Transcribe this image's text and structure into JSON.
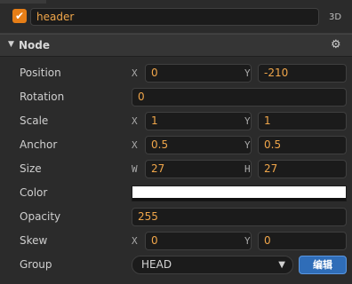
{
  "header": {
    "checked": true,
    "check_glyph": "✔",
    "node_name": "header",
    "mode_tag": "3D"
  },
  "section": {
    "caret": "▼",
    "title": "Node",
    "settings_glyph": "⚙"
  },
  "position": {
    "label": "Position",
    "x_axis": "X",
    "x": "0",
    "y_axis": "Y",
    "y": "-210"
  },
  "rotation": {
    "label": "Rotation",
    "value": "0"
  },
  "scale": {
    "label": "Scale",
    "x_axis": "X",
    "x": "1",
    "y_axis": "Y",
    "y": "1"
  },
  "anchor": {
    "label": "Anchor",
    "x_axis": "X",
    "x": "0.5",
    "y_axis": "Y",
    "y": "0.5"
  },
  "size": {
    "label": "Size",
    "w_axis": "W",
    "w": "27",
    "h_axis": "H",
    "h": "27"
  },
  "color": {
    "label": "Color",
    "value": "#ffffff"
  },
  "opacity": {
    "label": "Opacity",
    "value": "255"
  },
  "skew": {
    "label": "Skew",
    "x_axis": "X",
    "x": "0",
    "y_axis": "Y",
    "y": "0"
  },
  "group": {
    "label": "Group",
    "selected": "HEAD",
    "arrow": "▼",
    "edit_label": "编辑"
  },
  "colors": {
    "accent": "#e67e17",
    "value_text": "#f0a64a",
    "button": "#2f6db8"
  }
}
